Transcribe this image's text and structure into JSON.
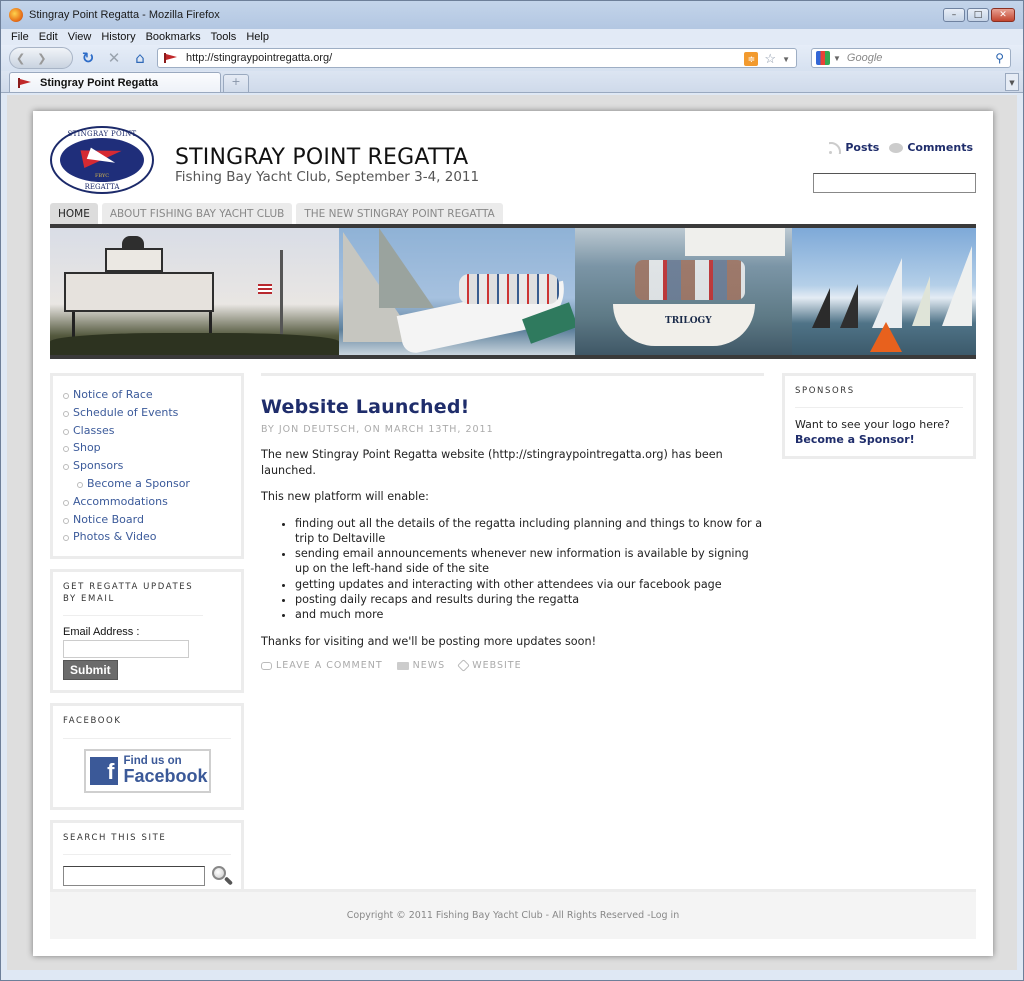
{
  "browser": {
    "window_title": "Stingray Point Regatta - Mozilla Firefox",
    "menu": [
      "File",
      "Edit",
      "View",
      "History",
      "Bookmarks",
      "Tools",
      "Help"
    ],
    "url": "http://stingraypointregatta.org/",
    "search_placeholder": "Google",
    "tab_title": "Stingray Point Regatta",
    "new_tab_glyph": "+"
  },
  "header": {
    "logo": {
      "top_text": "STINGRAY POINT",
      "middle_text": "FBYC",
      "bottom_text": "REGATTA"
    },
    "site_title": "STINGRAY POINT REGATTA",
    "tagline": "Fishing Bay Yacht Club, September 3-4, 2011",
    "feeds": {
      "posts": "Posts",
      "comments": "Comments"
    },
    "search_value": ""
  },
  "nav": {
    "tabs": [
      {
        "label": "HOME",
        "active": true
      },
      {
        "label": "ABOUT FISHING BAY YACHT CLUB",
        "active": false
      },
      {
        "label": "THE NEW STINGRAY POINT REGATTA",
        "active": false
      }
    ]
  },
  "banner": {
    "boat_name": "TRILOGY"
  },
  "sidebar_left": {
    "menu": [
      {
        "label": "Notice of Race",
        "sub": false
      },
      {
        "label": "Schedule of Events",
        "sub": false
      },
      {
        "label": "Classes",
        "sub": false
      },
      {
        "label": "Shop",
        "sub": false
      },
      {
        "label": "Sponsors",
        "sub": false
      },
      {
        "label": "Become a Sponsor",
        "sub": true
      },
      {
        "label": "Accommodations",
        "sub": false
      },
      {
        "label": "Notice Board",
        "sub": false
      },
      {
        "label": "Photos & Video",
        "sub": false
      }
    ],
    "email_widget": {
      "title": "GET REGATTA UPDATES BY EMAIL",
      "label": "Email Address :",
      "value": "",
      "submit": "Submit"
    },
    "facebook_widget": {
      "title": "FACEBOOK",
      "badge_line1": "Find us on",
      "badge_line2": "Facebook",
      "badge_glyph": "f"
    },
    "search_widget": {
      "title": "SEARCH THIS SITE",
      "value": ""
    }
  },
  "post": {
    "title": "Website Launched!",
    "meta": "BY JON DEUTSCH, ON MARCH 13TH, 2011",
    "intro": "The new Stingray Point Regatta website (http://stingraypointregatta.org) has been launched.",
    "lead": "This new platform will enable:",
    "bullets": [
      "finding out all the details of the regatta including planning and things to know for a trip to Deltaville",
      "sending email announcements whenever new information is available by signing up on the left-hand side of the site",
      "getting updates and interacting with other attendees via our facebook page",
      "posting daily recaps and results during the regatta",
      "and much more"
    ],
    "closing": "Thanks for visiting and we'll be posting more updates soon!",
    "footer": {
      "comment": "LEAVE A COMMENT",
      "category": "NEWS",
      "tag": "WEBSITE"
    }
  },
  "sidebar_right": {
    "sponsors_widget": {
      "title": "SPONSORS",
      "text": "Want to see your logo here?",
      "link": "Become a Sponsor!"
    }
  },
  "footer": {
    "copyright": "Copyright © 2011 Fishing Bay Yacht Club - All Rights Reserved - ",
    "login": "Log in"
  },
  "colors": {
    "link": "#3b5a9a",
    "heading": "#1f2d6b",
    "facebook": "#3b5998"
  }
}
